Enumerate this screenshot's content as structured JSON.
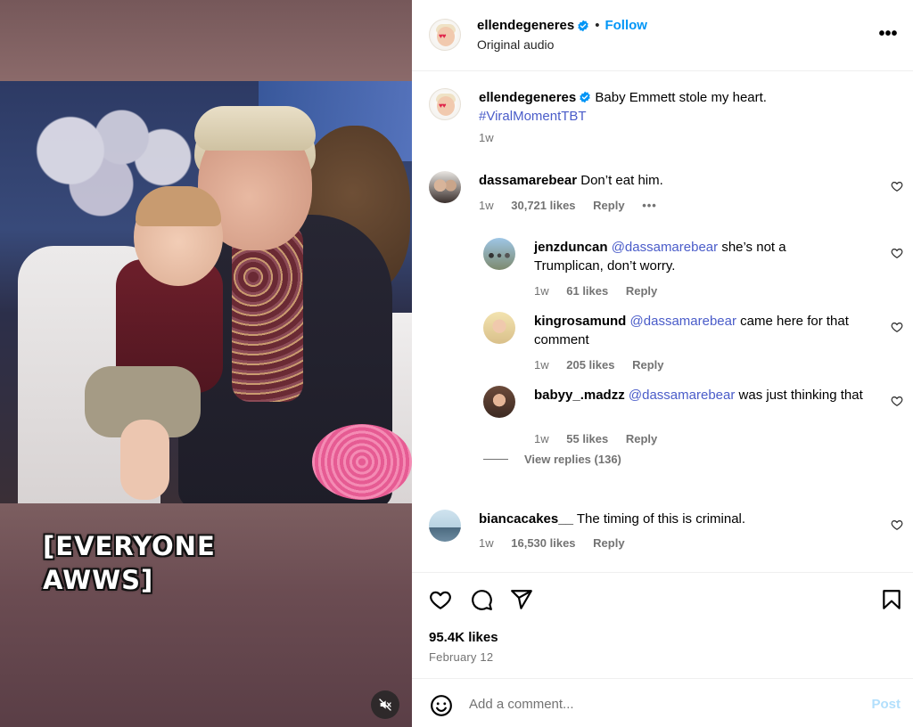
{
  "video": {
    "caption": "[EVERYONE AWWS]",
    "mute_icon": "muted-speaker-icon"
  },
  "header": {
    "username": "ellendegeneres",
    "separator": "•",
    "follow_label": "Follow",
    "audio": "Original audio",
    "more_icon": "more-options-icon",
    "more_label": "•••"
  },
  "caption_post": {
    "username": "ellendegeneres",
    "text": "Baby Emmett stole my heart.",
    "hashtag": "#ViralMomentTBT",
    "time": "1w"
  },
  "comments": [
    {
      "username": "dassamarebear",
      "text": "Don’t eat him.",
      "time": "1w",
      "likes": "30,721 likes",
      "reply": "Reply",
      "more": "•••"
    },
    {
      "username": "jenzduncan",
      "mention": "@dassamarebear",
      "text": "she’s not a Trumplican, don’t worry.",
      "time": "1w",
      "likes": "61 likes",
      "reply": "Reply"
    },
    {
      "username": "kingrosamund",
      "mention": "@dassamarebear",
      "text": "came here for that comment",
      "time": "1w",
      "likes": "205 likes",
      "reply": "Reply"
    },
    {
      "username": "babyy_.madzz",
      "mention": "@dassamarebear",
      "text": "was just thinking that",
      "time": "1w",
      "likes": "55 likes",
      "reply": "Reply"
    },
    {
      "username": "biancacakes__",
      "text": "The timing of this is criminal.",
      "time": "1w",
      "likes": "16,530 likes",
      "reply": "Reply"
    }
  ],
  "view_replies": "View replies (136)",
  "actions": {
    "likes": "95.4K likes",
    "date": "February 12",
    "icons": [
      "heart-icon",
      "comment-icon",
      "share-icon",
      "bookmark-icon"
    ]
  },
  "add_comment": {
    "placeholder": "Add a comment...",
    "post_label": "Post",
    "emoji_icon": "emoji-icon"
  },
  "colors": {
    "link": "#4a5cc9",
    "follow": "#0095f6",
    "muted_text": "#737373",
    "post_disabled": "#b2dffc"
  }
}
